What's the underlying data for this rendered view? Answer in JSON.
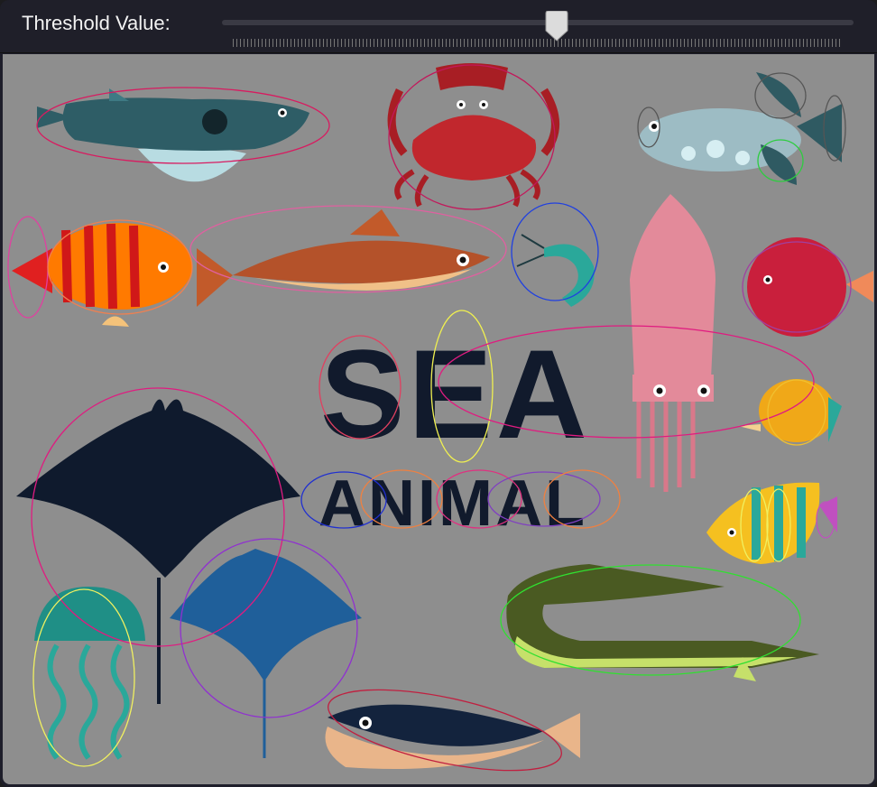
{
  "toolbar": {
    "threshold_label": "Threshold Value:",
    "threshold_level": 0.53
  },
  "poster": {
    "title_line1": "SEA",
    "title_line2": "ANIMAL"
  },
  "colors": {
    "canvas_bg": "#8e8e8e",
    "toolbar_bg": "#1f1f29",
    "navy": "#111a2c",
    "crab_red": "#c1272d",
    "squid_pink": "#e38a9a",
    "eel_green": "#4a5a22",
    "eel_light": "#c6e06a",
    "teal": "#2aa89a"
  },
  "detections": [
    {
      "object": "blowfish",
      "color": "#d81b60"
    },
    {
      "object": "crab",
      "color": "#c2185b"
    },
    {
      "object": "puffer-body",
      "color": "#555555"
    },
    {
      "object": "puffer-fin",
      "color": "#555555"
    },
    {
      "object": "puffer-tail",
      "color": "#555555"
    },
    {
      "object": "puffer-lower-fin",
      "color": "#2ecc40"
    },
    {
      "object": "puffer-face",
      "color": "#555555"
    },
    {
      "object": "orange-fish-tail",
      "color": "#e040a0"
    },
    {
      "object": "orange-fish",
      "color": "#f08050"
    },
    {
      "object": "brown-fish",
      "color": "#e060a0"
    },
    {
      "object": "shrimp",
      "color": "#2040e0"
    },
    {
      "object": "red-fish",
      "color": "#a040a0"
    },
    {
      "object": "letter-s",
      "color": "#e04060"
    },
    {
      "object": "letter-e",
      "color": "#f0f050"
    },
    {
      "object": "squid",
      "color": "#e01b80"
    },
    {
      "object": "small-yellow-fish",
      "color": "#f0c030"
    },
    {
      "object": "manta-ray",
      "color": "#e01b80"
    },
    {
      "object": "letter-a",
      "color": "#2030d0"
    },
    {
      "object": "letter-n",
      "color": "#f08040"
    },
    {
      "object": "letter-i",
      "color": "#e03080"
    },
    {
      "object": "letter-m",
      "color": "#8040c0"
    },
    {
      "object": "letter-al",
      "color": "#f08040"
    },
    {
      "object": "striped-fish",
      "color": "#f0f060"
    },
    {
      "object": "striped-fish-tail",
      "color": "#c050c0"
    },
    {
      "object": "eel",
      "color": "#30e030"
    },
    {
      "object": "jellyfish",
      "color": "#f0f060"
    },
    {
      "object": "blue-ray",
      "color": "#9030d0"
    },
    {
      "object": "dark-fish",
      "color": "#c02040"
    }
  ]
}
